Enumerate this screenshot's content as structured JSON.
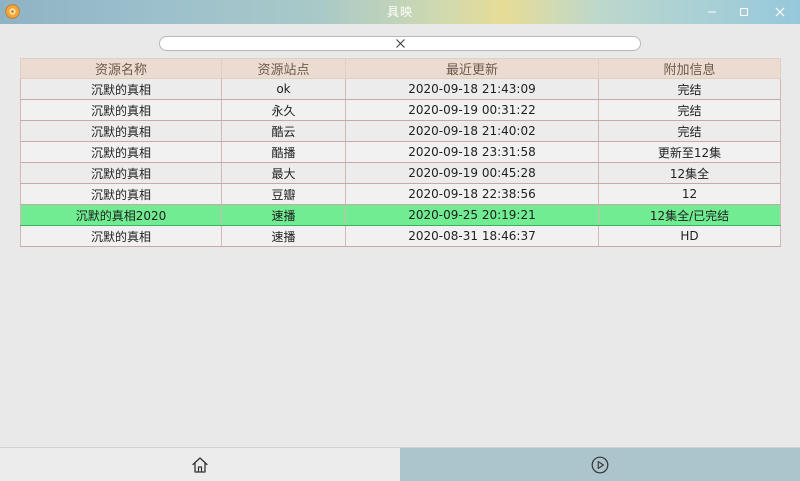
{
  "window": {
    "title": "具映"
  },
  "search": {
    "value": ""
  },
  "table": {
    "columns": [
      "资源名称",
      "资源站点",
      "最近更新",
      "附加信息"
    ],
    "rows": [
      {
        "name": "沉默的真相",
        "site": "ok",
        "updated": "2020-09-18 21:43:09",
        "info": "完结"
      },
      {
        "name": "沉默的真相",
        "site": "永久",
        "updated": "2020-09-19 00:31:22",
        "info": "完结"
      },
      {
        "name": "沉默的真相",
        "site": "酷云",
        "updated": "2020-09-18 21:40:02",
        "info": "完结"
      },
      {
        "name": "沉默的真相",
        "site": "酷播",
        "updated": "2020-09-18 23:31:58",
        "info": "更新至12集"
      },
      {
        "name": "沉默的真相",
        "site": "最大",
        "updated": "2020-09-19 00:45:28",
        "info": "12集全"
      },
      {
        "name": "沉默的真相",
        "site": "豆瓣",
        "updated": "2020-09-18 22:38:56",
        "info": "12"
      },
      {
        "name": "沉默的真相2020",
        "site": "速播",
        "updated": "2020-09-25 20:19:21",
        "info": "12集全/已完结"
      },
      {
        "name": "沉默的真相",
        "site": "速播",
        "updated": "2020-08-31 18:46:37",
        "info": "HD"
      }
    ],
    "selected_index": 6
  },
  "icons": {
    "app": "app-logo-icon",
    "minimize": "minimize-icon",
    "maximize": "maximize-icon",
    "close": "close-icon",
    "clear_search": "close-icon",
    "home": "home-icon",
    "play": "play-circle-icon"
  },
  "colors": {
    "selected_row": "#71ec92",
    "header_bg": "#ebdbd0",
    "header_text": "#6e5a4c",
    "active_nav": "#acc4cc"
  }
}
